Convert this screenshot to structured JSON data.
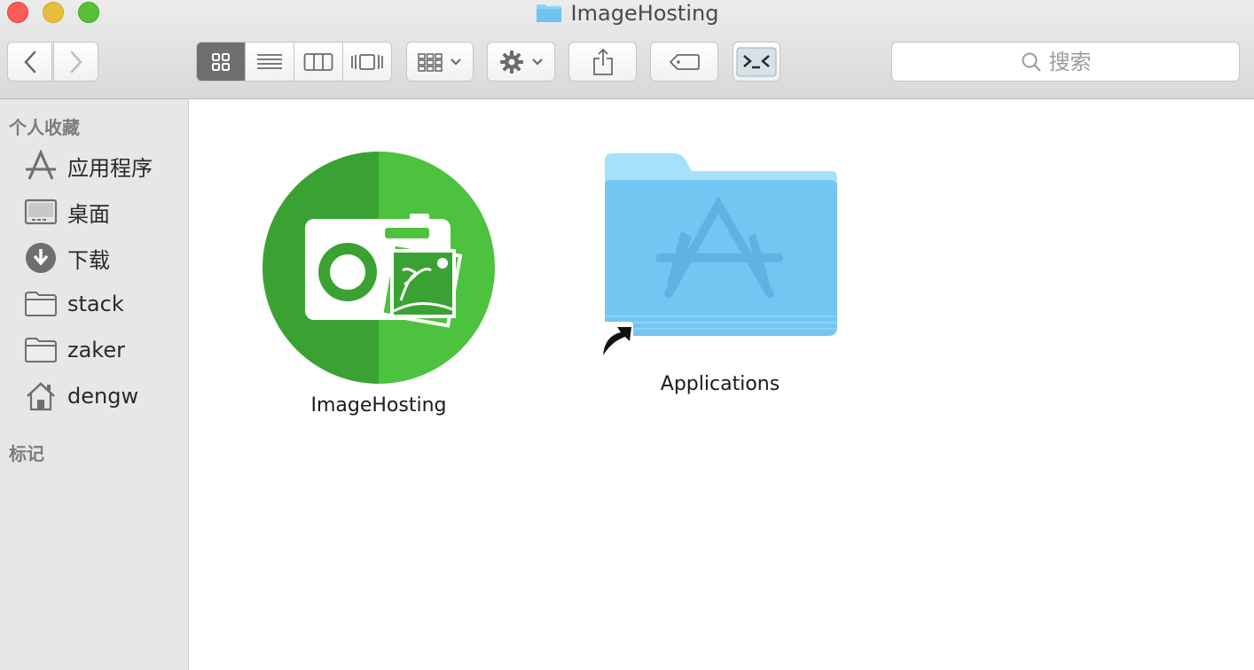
{
  "window": {
    "title": "ImageHosting"
  },
  "toolbar": {
    "back_icon": "chevron-left-icon",
    "forward_icon": "chevron-right-icon",
    "view_modes": [
      "icon-view",
      "list-view",
      "column-view",
      "cover-flow-view"
    ],
    "active_view": "icon-view",
    "arrange_icon": "arrange-grid-icon",
    "action_icon": "gear-icon",
    "share_icon": "share-icon",
    "tag_icon": "tag-icon",
    "terminal_icon": "terminal-icon",
    "search_placeholder": "搜索"
  },
  "sidebar": {
    "favorites_header": "个人收藏",
    "items": [
      {
        "label": "应用程序",
        "icon": "applications-icon"
      },
      {
        "label": "桌面",
        "icon": "desktop-icon"
      },
      {
        "label": "下载",
        "icon": "downloads-icon"
      },
      {
        "label": "stack",
        "icon": "folder-icon"
      },
      {
        "label": "zaker",
        "icon": "folder-icon"
      },
      {
        "label": "dengw",
        "icon": "home-icon"
      }
    ],
    "tags_header": "标记"
  },
  "files": [
    {
      "name": "ImageHosting",
      "icon": "imagehosting-app-icon"
    },
    {
      "name": "Applications",
      "icon": "applications-folder-alias-icon"
    }
  ],
  "colors": {
    "folder_blue": "#74c6f2",
    "app_green_dark": "#3aa232",
    "app_green_light": "#4dc23e"
  }
}
